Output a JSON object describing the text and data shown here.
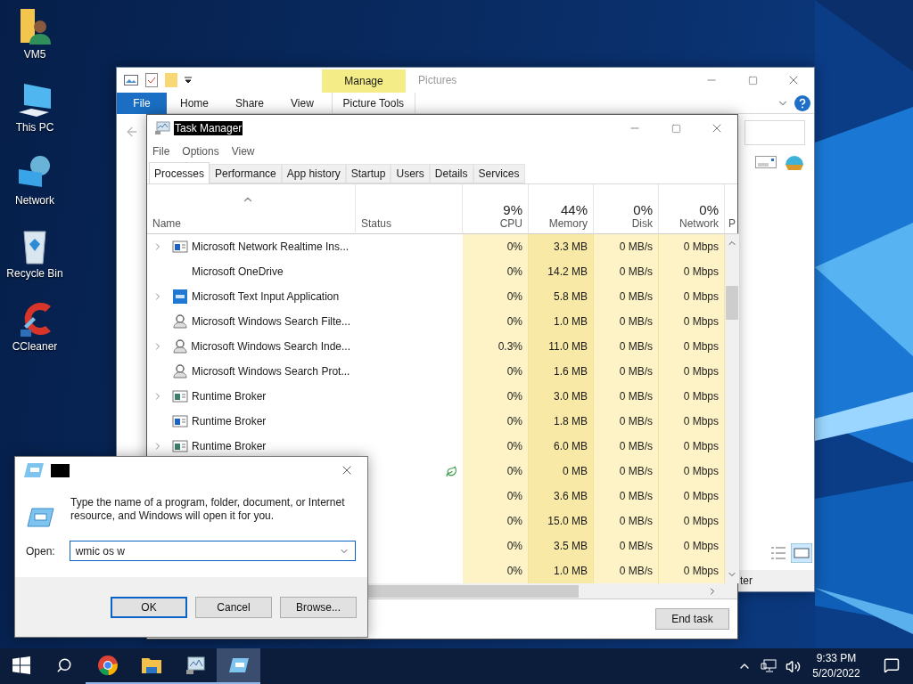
{
  "desktop_icons": [
    {
      "label": "VM5",
      "kind": "user-folder"
    },
    {
      "label": "This PC",
      "kind": "computer"
    },
    {
      "label": "Network",
      "kind": "network"
    },
    {
      "label": "Recycle Bin",
      "kind": "recycle"
    },
    {
      "label": "CCleaner",
      "kind": "cleaner"
    }
  ],
  "explorer": {
    "title": "Pictures",
    "context_tab": "Manage",
    "ribbon_tabs": [
      {
        "label": "File",
        "kind": "file",
        "selected": false
      },
      {
        "label": "Home",
        "kind": "plain",
        "selected": false
      },
      {
        "label": "Share",
        "kind": "plain",
        "selected": false
      },
      {
        "label": "View",
        "kind": "plain",
        "selected": false
      },
      {
        "label": "Picture Tools",
        "kind": "context",
        "selected": false
      }
    ],
    "status_text": "ter"
  },
  "task_manager": {
    "title": "Task Manager",
    "title_highlighted": true,
    "menu": [
      "File",
      "Options",
      "View"
    ],
    "tabs": [
      {
        "label": "Processes",
        "selected": true
      },
      {
        "label": "Performance",
        "selected": false
      },
      {
        "label": "App history",
        "selected": false
      },
      {
        "label": "Startup",
        "selected": false
      },
      {
        "label": "Users",
        "selected": false
      },
      {
        "label": "Details",
        "selected": false
      },
      {
        "label": "Services",
        "selected": false
      }
    ],
    "columns": [
      {
        "label": "Name"
      },
      {
        "label": "Status"
      },
      {
        "label": "CPU",
        "usage": "9%"
      },
      {
        "label": "Memory",
        "usage": "44%"
      },
      {
        "label": "Disk",
        "usage": "0%"
      },
      {
        "label": "Network",
        "usage": "0%"
      },
      {
        "label": "P"
      }
    ],
    "rows": [
      {
        "name": "Microsoft Network Realtime Ins...",
        "kind": "window",
        "expandable": true,
        "cpu": "0%",
        "memory": "3.3 MB",
        "disk": "0 MB/s",
        "network": "0 Mbps"
      },
      {
        "name": "Microsoft OneDrive",
        "kind": "plain",
        "expandable": false,
        "cpu": "0%",
        "memory": "14.2 MB",
        "disk": "0 MB/s",
        "network": "0 Mbps"
      },
      {
        "name": "Microsoft Text Input Application",
        "kind": "keyboard",
        "expandable": true,
        "cpu": "0%",
        "memory": "5.8 MB",
        "disk": "0 MB/s",
        "network": "0 Mbps"
      },
      {
        "name": "Microsoft Windows Search Filte...",
        "kind": "search",
        "expandable": false,
        "cpu": "0%",
        "memory": "1.0 MB",
        "disk": "0 MB/s",
        "network": "0 Mbps"
      },
      {
        "name": "Microsoft Windows Search Inde...",
        "kind": "search",
        "expandable": true,
        "cpu": "0.3%",
        "memory": "11.0 MB",
        "disk": "0 MB/s",
        "network": "0 Mbps"
      },
      {
        "name": "Microsoft Windows Search Prot...",
        "kind": "search",
        "expandable": false,
        "cpu": "0%",
        "memory": "1.6 MB",
        "disk": "0 MB/s",
        "network": "0 Mbps"
      },
      {
        "name": "Runtime Broker",
        "kind": "app",
        "expandable": true,
        "cpu": "0%",
        "memory": "3.0 MB",
        "disk": "0 MB/s",
        "network": "0 Mbps"
      },
      {
        "name": "Runtime Broker",
        "kind": "window",
        "expandable": false,
        "cpu": "0%",
        "memory": "1.8 MB",
        "disk": "0 MB/s",
        "network": "0 Mbps"
      },
      {
        "name": "Runtime Broker",
        "kind": "app",
        "expandable": true,
        "cpu": "0%",
        "memory": "6.0 MB",
        "disk": "0 MB/s",
        "network": "0 Mbps"
      },
      {
        "kind": "efficiency",
        "cpu": "0%",
        "memory": "0 MB",
        "disk": "0 MB/s",
        "network": "0 Mbps"
      },
      {
        "cpu": "0%",
        "memory": "3.6 MB",
        "disk": "0 MB/s",
        "network": "0 Mbps"
      },
      {
        "cpu": "0%",
        "memory": "15.0 MB",
        "disk": "0 MB/s",
        "network": "0 Mbps"
      },
      {
        "cpu": "0%",
        "memory": "3.5 MB",
        "disk": "0 MB/s",
        "network": "0 Mbps"
      },
      {
        "cpu": "0%",
        "memory": "1.0 MB",
        "disk": "0 MB/s",
        "network": "0 Mbps"
      }
    ],
    "button": "End task"
  },
  "run_dialog": {
    "prompt": "Type the name of a program, folder, document, or Internet resource, and Windows will open it for you.",
    "open_label": "Open:",
    "value": "wmic os w",
    "buttons": [
      {
        "label": "OK",
        "default": true
      },
      {
        "label": "Cancel",
        "default": false
      },
      {
        "label": "Browse...",
        "default": false
      }
    ]
  },
  "taskbar": {
    "apps": [
      {
        "kind": "chrome",
        "open": true,
        "active": false
      },
      {
        "kind": "folder",
        "open": true,
        "active": false
      },
      {
        "kind": "monitor",
        "open": true,
        "active": false
      },
      {
        "kind": "run",
        "open": true,
        "active": true
      }
    ],
    "time": "9:33 PM",
    "date": "5/20/2022"
  }
}
